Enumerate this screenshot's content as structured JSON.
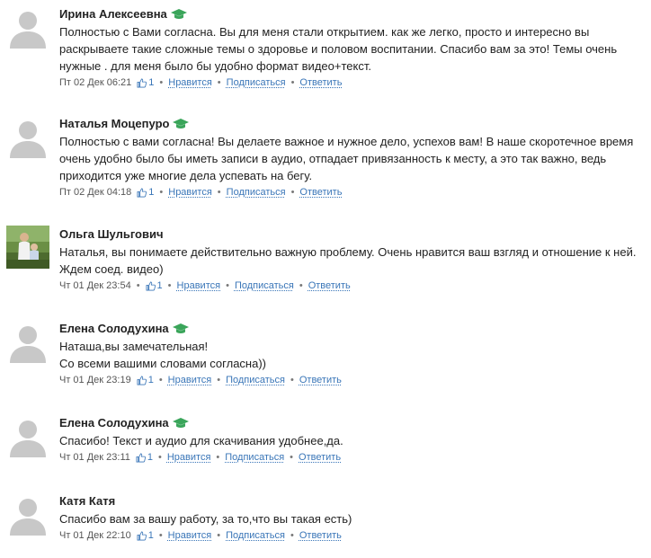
{
  "comments": [
    {
      "author": "Ирина Алексеевна",
      "badge": true,
      "text": "Полностью с Вами согласна. Вы для меня стали открытием. как же легко, просто и интересно вы раскрываете такие сложные темы о здоровье и половом воспитании. Спасибо вам за это! Темы очень нужные . для меня было бы удобно формат видео+текст.",
      "date": "Пт 02 Дек 06:21",
      "likes": "1",
      "like_label": "Нравится",
      "subscribe_label": "Подписаться",
      "reply_label": "Ответить"
    },
    {
      "author": "Наталья Моцепуро",
      "badge": true,
      "text": "Полностью с вами согласна! Вы делаете важное и нужное дело, успехов вам! В наше скоротечное время очень удобно было бы иметь записи в аудио, отпадает привязанность к месту, а это так важно, ведь приходится уже многие дела успевать на бегу.",
      "date": "Пт 02 Дек 04:18",
      "likes": "1",
      "like_label": "Нравится",
      "subscribe_label": "Подписаться",
      "reply_label": "Ответить"
    },
    {
      "author": "Ольга Шульгович",
      "badge": false,
      "text": "Наталья, вы понимаете действительно важную проблему. Очень нравится ваш взгляд и отношение к ней. Ждем соед. видео)",
      "date": "Чт 01 Дек 23:54",
      "likes": "1",
      "like_label": "Нравится",
      "subscribe_label": "Подписаться",
      "reply_label": "Ответить"
    },
    {
      "author": "Елена Солодухина",
      "badge": true,
      "text": "Наташа,вы замечательная!\nСо всеми вашими словами согласна))",
      "date": "Чт 01 Дек 23:19",
      "likes": "1",
      "like_label": "Нравится",
      "subscribe_label": "Подписаться",
      "reply_label": "Ответить"
    },
    {
      "author": "Елена Солодухина",
      "badge": true,
      "text": "Спасибо! Текст и аудио для скачивания удобнее,да.",
      "date": "Чт 01 Дек 23:11",
      "likes": "1",
      "like_label": "Нравится",
      "subscribe_label": "Подписаться",
      "reply_label": "Ответить"
    },
    {
      "author": "Катя Катя",
      "badge": false,
      "text": "Спасибо вам за вашу работу, за то,что вы такая есть)",
      "date": "Чт 01 Дек 22:10",
      "likes": "1",
      "like_label": "Нравится",
      "subscribe_label": "Подписаться",
      "reply_label": "Ответить"
    }
  ],
  "colors": {
    "link": "#3a76b8",
    "badge": "#3aa55a",
    "avatar_placeholder": "#c8c8c8"
  }
}
